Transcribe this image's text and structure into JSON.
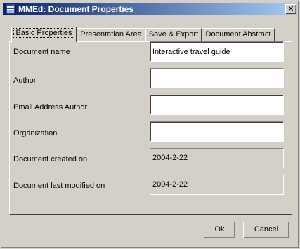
{
  "window": {
    "title": "MMEd: Document Properties",
    "close_glyph": "✕",
    "app_icon": "mmed-app-icon"
  },
  "tabs": [
    {
      "label": "Basic Properties",
      "active": true
    },
    {
      "label": "Presentation Area",
      "active": false
    },
    {
      "label": "Save & Export",
      "active": false
    },
    {
      "label": "Document Abstract",
      "active": false
    }
  ],
  "form": {
    "document_name": {
      "label": "Document name",
      "value": "Interactive travel guide"
    },
    "author": {
      "label": "Author",
      "value": ""
    },
    "email_author": {
      "label": "Email Address Author",
      "value": ""
    },
    "organization": {
      "label": "Organization",
      "value": ""
    },
    "created_on": {
      "label": "Document created on",
      "value": "2004-2-22"
    },
    "last_modified_on": {
      "label": "Document last modified on",
      "value": "2004-2-22"
    }
  },
  "buttons": {
    "ok": "Ok",
    "cancel": "Cancel"
  }
}
